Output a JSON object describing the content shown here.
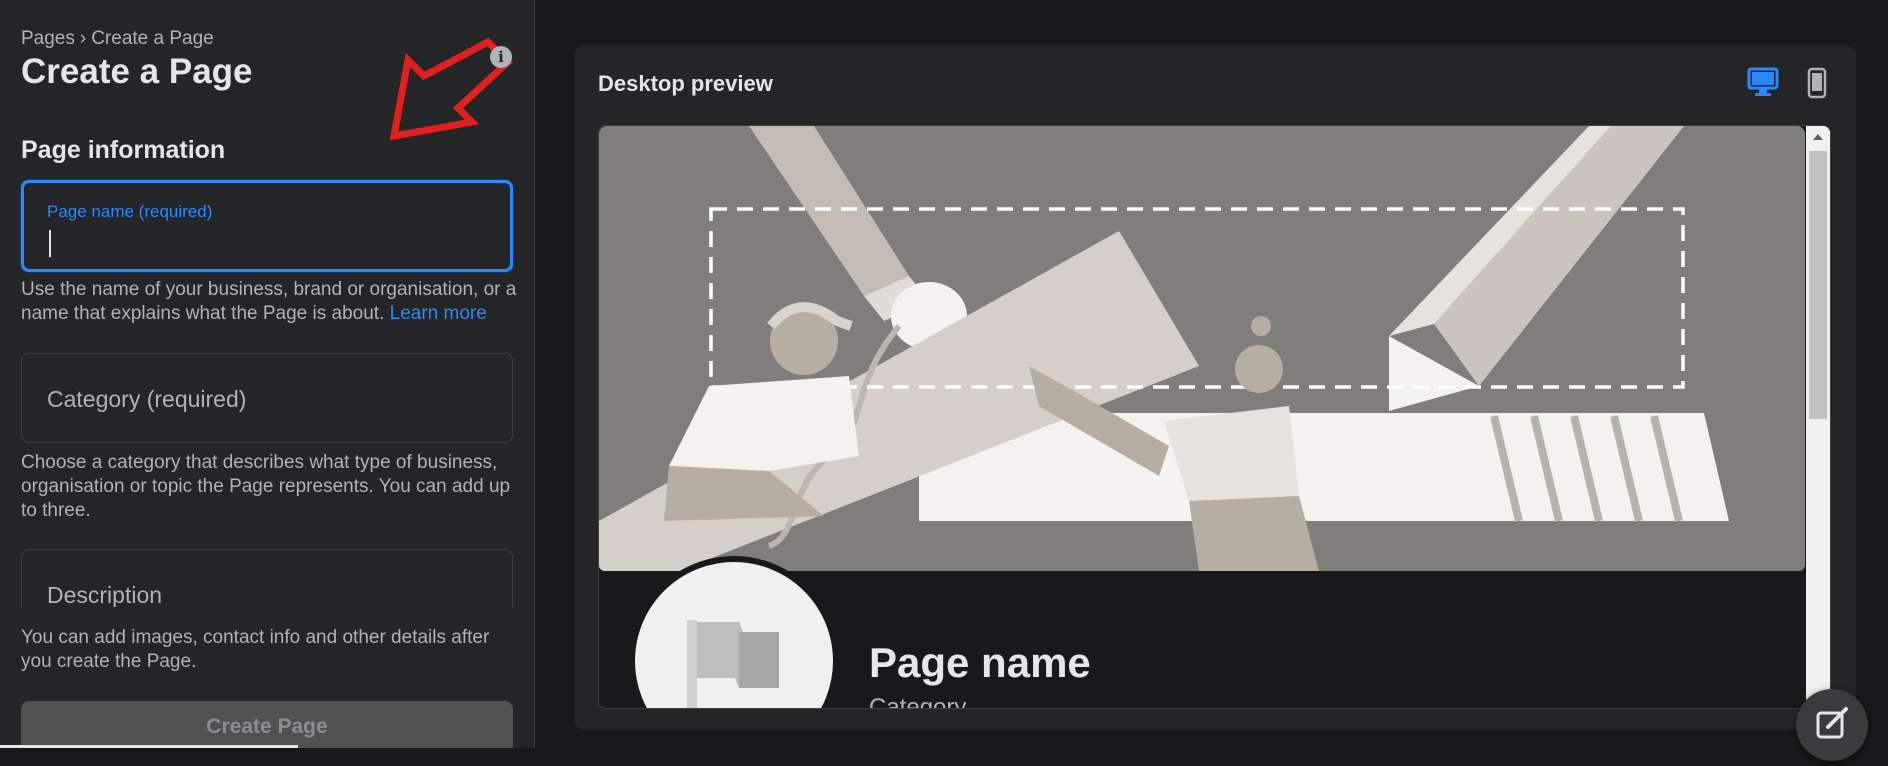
{
  "breadcrumb": {
    "root": "Pages",
    "separator": "›",
    "current": "Create a Page"
  },
  "page_title": "Create a Page",
  "section_title": "Page information",
  "page_name_field": {
    "label": "Page name (required)",
    "value": ""
  },
  "page_name_helper": "Use the name of your business, brand or organisation, or a name that explains what the Page is about.",
  "learn_more": "Learn more",
  "category_field": {
    "placeholder": "Category (required)"
  },
  "category_helper": "Choose a category that describes what type of business, organisation or topic the Page represents. You can add up to three.",
  "description_field": {
    "placeholder": "Description"
  },
  "bottom_helper": "You can add images, contact info and other details after you create the Page.",
  "create_button": "Create Page",
  "preview": {
    "title": "Desktop preview",
    "page_name": "Page name",
    "category": "Category"
  },
  "colors": {
    "accent": "#2d88ff",
    "panel": "#242526",
    "background": "#18191a",
    "annotation_arrow": "#e02020"
  },
  "icons": [
    "info-icon",
    "desktop-icon",
    "mobile-icon",
    "flag-icon",
    "compose-icon"
  ]
}
